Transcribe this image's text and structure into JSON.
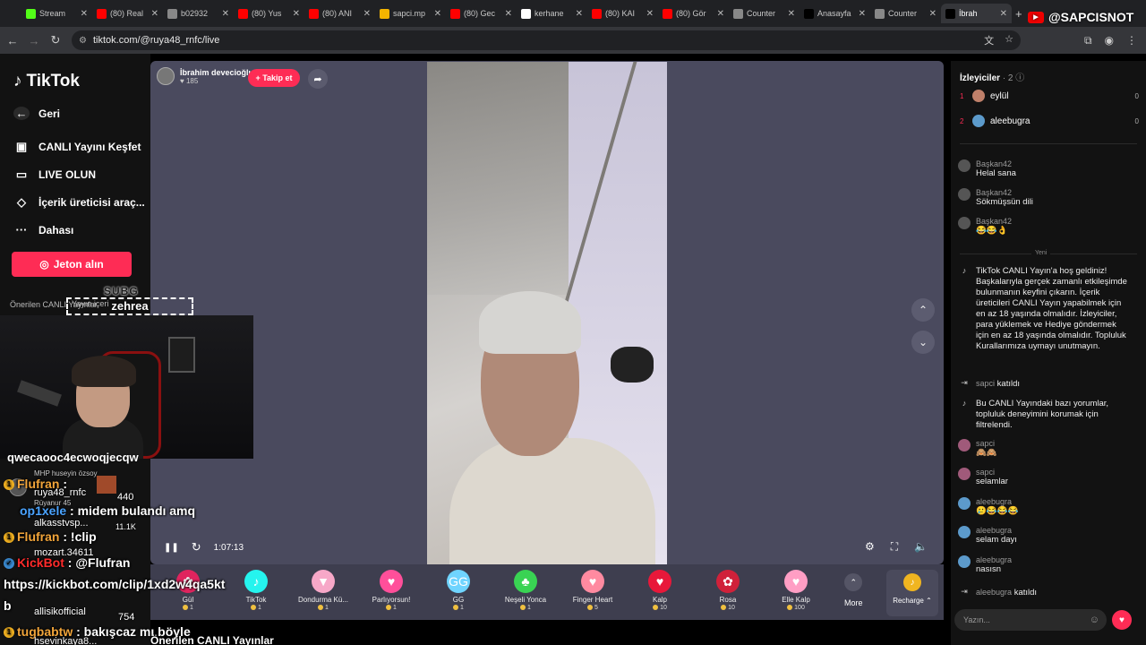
{
  "browser": {
    "tabs": [
      {
        "label": "Stream",
        "icon": "kick-icon",
        "color": "#53fc18"
      },
      {
        "label": "(80) Real",
        "icon": "youtube-icon",
        "color": "#ff0000"
      },
      {
        "label": "b02932",
        "icon": "globe-icon",
        "color": "#888888"
      },
      {
        "label": "(80) Yus",
        "icon": "youtube-icon",
        "color": "#ff0000"
      },
      {
        "label": "(80) ANI",
        "icon": "youtube-icon",
        "color": "#ff0000"
      },
      {
        "label": "sapci.mp",
        "icon": "drive-icon",
        "color": "#f4b400"
      },
      {
        "label": "(80) Gec",
        "icon": "youtube-icon",
        "color": "#ff0000"
      },
      {
        "label": "kerhane",
        "icon": "google-icon",
        "color": "#ffffff"
      },
      {
        "label": "(80) KAI",
        "icon": "youtube-icon",
        "color": "#ff0000"
      },
      {
        "label": "(80) Gör",
        "icon": "youtube-icon",
        "color": "#ff0000"
      },
      {
        "label": "Counter",
        "icon": "globe-icon",
        "color": "#888888"
      },
      {
        "label": "Anasayfa",
        "icon": "x-icon",
        "color": "#000000"
      },
      {
        "label": "Counter",
        "icon": "globe-icon",
        "color": "#888888"
      },
      {
        "label": "İbrah",
        "icon": "tiktok-icon",
        "color": "#000000"
      }
    ],
    "url": "tiktok.com/@ruya48_rnfc/live",
    "channel_overlay": "@SAPCISNOT"
  },
  "sidebar": {
    "logo": "TikTok",
    "items": [
      {
        "label": "Geri",
        "icon": "arrow-left-icon"
      },
      {
        "label": "CANLI Yayını Keşfet",
        "icon": "explore-icon"
      },
      {
        "label": "LIVE OLUN",
        "icon": "video-camera-icon"
      },
      {
        "label": "İçerik üreticisi araç...",
        "icon": "lightbulb-icon"
      },
      {
        "label": "Dahası",
        "icon": "more-dots-icon"
      }
    ],
    "jeton_button": "Jeton alın",
    "recommended": "Önerilen CANLI Yayınlar",
    "recommended_partial": "Yayın içeri"
  },
  "stream": {
    "streamer_name": "İbrahim devecioğlu",
    "likes": "185",
    "follow_label": "+ Takip et",
    "elapsed": "1:07:13"
  },
  "gifts": [
    {
      "name": "Gül",
      "price": "1",
      "color": "#e0245e",
      "glyph": "✿"
    },
    {
      "name": "TikTok",
      "price": "1",
      "color": "#25f4ee",
      "glyph": "♪"
    },
    {
      "name": "Dondurma Kü...",
      "price": "1",
      "color": "#f7a8c8",
      "glyph": "▼"
    },
    {
      "name": "Parlıyorsun!",
      "price": "1",
      "color": "#ff4f9a",
      "glyph": "♥"
    },
    {
      "name": "GG",
      "price": "1",
      "color": "#6fd4ff",
      "glyph": "GG"
    },
    {
      "name": "Neşeli Yonca",
      "price": "1",
      "color": "#39d353",
      "glyph": "♣"
    },
    {
      "name": "Finger Heart",
      "price": "5",
      "color": "#ff8aa0",
      "glyph": "♥"
    },
    {
      "name": "Kalp",
      "price": "10",
      "color": "#e8183a",
      "glyph": "♥"
    },
    {
      "name": "Rosa",
      "price": "10",
      "color": "#d0213a",
      "glyph": "✿"
    },
    {
      "name": "Elle Kalp",
      "price": "100",
      "color": "#ff9ec4",
      "glyph": "♥"
    }
  ],
  "more_label": "More",
  "recharge_label": "Recharge",
  "chat": {
    "viewers_title": "İzleyiciler",
    "viewers_count": "· 2",
    "viewers": [
      {
        "rank": "1",
        "name": "eylül",
        "score": "0",
        "color": "#c0806a"
      },
      {
        "rank": "2",
        "name": "aleebugra",
        "score": "0",
        "color": "#5c9acb"
      }
    ],
    "separator": "Yeni",
    "messages": [
      {
        "user": "Başkan42",
        "text": "Helal sana",
        "color": "#555555"
      },
      {
        "user": "Başkan42",
        "text": "Sökmüşsün dili",
        "color": "#555555"
      },
      {
        "user": "Başkan42",
        "text": "😂😂👌",
        "color": "#555555"
      }
    ],
    "system_welcome": "TikTok CANLI Yayın'a hoş geldiniz! Başkalarıyla gerçek zamanlı etkileşimde bulunmanın keyfini çıkarın. İçerik üreticileri CANLI Yayın yapabilmek için en az 18 yaşında olmalıdır. İzleyiciler, para yüklemek ve Hediye göndermek için en az 18 yaşında olmalıdır. Topluluk Kurallarımıza uymayı unutmayın.",
    "join1_user": "sapci",
    "join1_text": "katıldı",
    "system_filter": "Bu CANLI Yayındaki bazı yorumlar, topluluk deneyimini korumak için filtrelendi.",
    "messages2": [
      {
        "user": "sapci",
        "text": "🙈🙈",
        "color": "#a05a7a"
      },
      {
        "user": "sapci",
        "text": "selamlar",
        "color": "#a05a7a"
      },
      {
        "user": "aleebugra",
        "text": "🥲😂😂😂",
        "color": "#5c9acb"
      },
      {
        "user": "aleebugra",
        "text": "selam dayı",
        "color": "#5c9acb"
      },
      {
        "user": "aleebugra",
        "text": "nasısn",
        "color": "#5c9acb"
      }
    ],
    "join2_user": "aleebugra",
    "join2_text": "katıldı",
    "input_placeholder": "Yazın..."
  },
  "overlay": {
    "subg": "SUBG",
    "zehrea": "zehrea",
    "lines": [
      {
        "user": "Flufran",
        "sep": " : ",
        "text": "",
        "cls": "user"
      },
      {
        "user": "op1xele",
        "sep": " : ",
        "text": "midem bulandı amq",
        "cls": "user blue"
      },
      {
        "user": "Flufran",
        "sep": " : ",
        "text": "!clip",
        "cls": "user"
      },
      {
        "user": "KickBot",
        "sep": " : ",
        "text": "@Flufran",
        "cls": "user red"
      },
      {
        "user": "",
        "sep": "",
        "text": "https://kickbot.com/clip/1xd2w4qa5kt",
        "cls": "user"
      },
      {
        "user": "tugbabtw",
        "sep": " : ",
        "text": "bakışcaz mı böyle",
        "cls": "user"
      }
    ],
    "top_text": "qwecaooc4ecwoqjecqw",
    "under_names": [
      {
        "name": "MHP huseyin özsoy",
        "score": ""
      },
      {
        "name": "ruya48_rnfc",
        "score": "440"
      },
      {
        "name": "Rüyanur 45",
        "score": ""
      },
      {
        "name": "alkasstvsp...",
        "score": "11.1K"
      },
      {
        "name": "mozart.34611",
        "score": ""
      },
      {
        "name": "allisikofficial",
        "score": "754"
      },
      {
        "name": "hsevinkaya8...",
        "score": ""
      }
    ],
    "bottom_label": "Önerilen CANLI Yayınlar"
  }
}
